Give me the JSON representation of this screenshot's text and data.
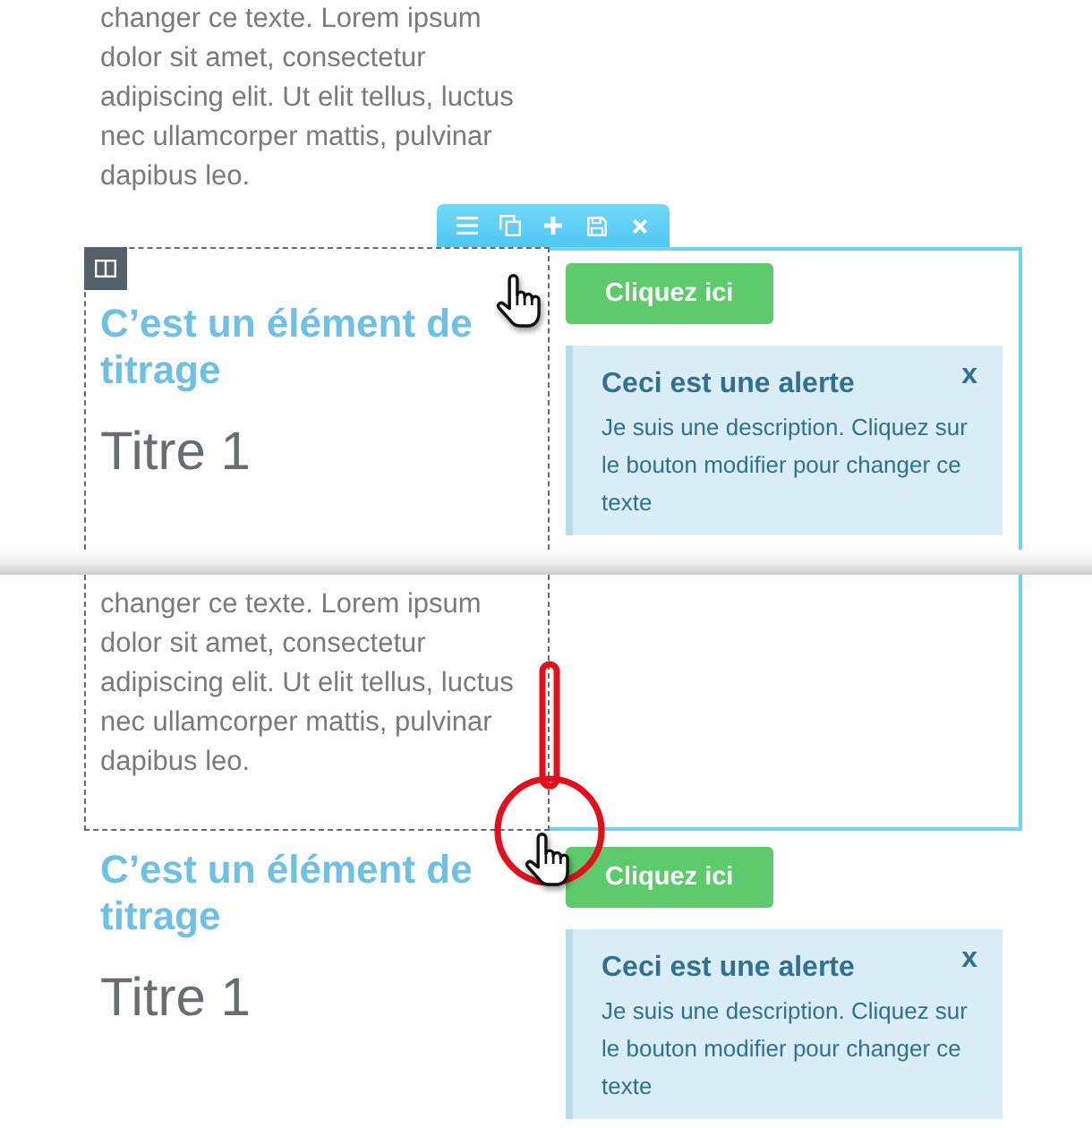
{
  "views": [
    {
      "blocks": [
        {
          "kind": "text",
          "lines": [
            "changer ce texte. Lorem ipsum",
            "dolor sit amet, consectetur",
            "adipiscing elit. Ut elit tellus, luctus",
            "nec ullamcorper mattis, pulvinar",
            "dapibus leo."
          ]
        },
        {
          "kind": "toolbar"
        },
        {
          "kind": "section",
          "selected": true,
          "columns": [
            {
              "outlined": true,
              "overlays": [
                {
                  "kind": "handle"
                },
                {
                  "kind": "pointer"
                }
              ],
              "widgets": [
                {
                  "kind": "heading",
                  "text": "C’est un élément de titrage"
                },
                {
                  "kind": "title",
                  "text": "Titre 1"
                }
              ]
            },
            {
              "outlined": false,
              "widgets": [
                {
                  "kind": "button",
                  "label": "Cliquez ici"
                },
                {
                  "kind": "alert",
                  "title": "Ceci est une alerte",
                  "close": "x",
                  "lines": [
                    "Je suis une description. Cliquez sur",
                    "le bouton modifier pour changer ce",
                    "texte"
                  ]
                }
              ]
            }
          ]
        }
      ]
    },
    {
      "blocks": [
        {
          "kind": "section",
          "selected": true,
          "columns": [
            {
              "outlined": true,
              "overlays": [
                {
                  "kind": "resize_highlight"
                }
              ],
              "widgets": [
                {
                  "kind": "text",
                  "lines": [
                    "changer ce texte. Lorem ipsum",
                    "dolor sit amet, consectetur",
                    "adipiscing elit. Ut elit tellus, luctus",
                    "nec ullamcorper mattis, pulvinar",
                    "dapibus leo."
                  ]
                }
              ]
            },
            {
              "outlined": false
            }
          ]
        },
        {
          "kind": "section",
          "selected": false,
          "columns": [
            {
              "outlined": false,
              "widgets": [
                {
                  "kind": "heading",
                  "text": "C’est un élément de titrage"
                },
                {
                  "kind": "title",
                  "text": "Titre 1"
                }
              ]
            },
            {
              "outlined": false,
              "widgets": [
                {
                  "kind": "button",
                  "label": "Cliquez ici"
                },
                {
                  "kind": "alert",
                  "title": "Ceci est une alerte",
                  "close": "x",
                  "lines": [
                    "Je suis une description. Cliquez sur",
                    "le bouton modifier pour changer ce",
                    "texte"
                  ]
                }
              ]
            }
          ]
        }
      ]
    }
  ]
}
